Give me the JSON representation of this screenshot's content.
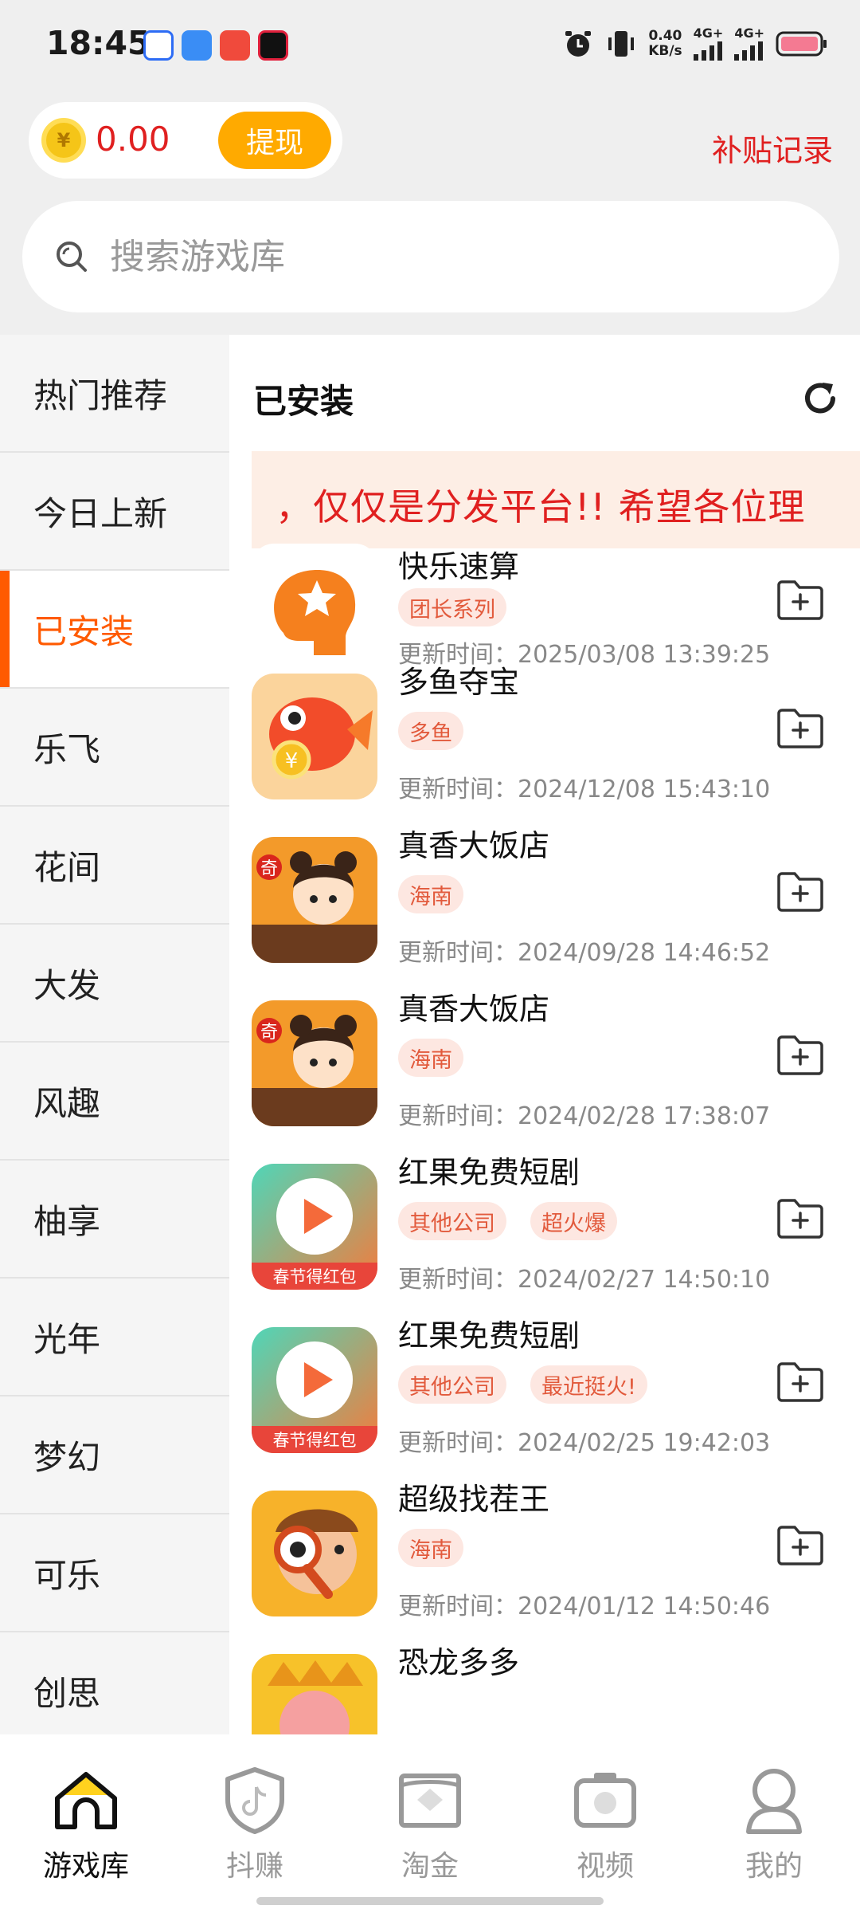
{
  "status_bar": {
    "time": "18:45",
    "net_speed_value": "0.40",
    "net_speed_unit": "KB/s",
    "sim1": "4G+",
    "sim2": "4G+",
    "icons": [
      "baidu-icon",
      "files-icon",
      "app-icon",
      "douyin-icon",
      "alarm-icon",
      "vibrate-icon",
      "signal-icon",
      "battery-icon"
    ]
  },
  "header": {
    "balance": "0.00",
    "coin_symbol": "¥",
    "withdraw_label": "提现",
    "subsidy_link": "补贴记录"
  },
  "search": {
    "placeholder": "搜索游戏库"
  },
  "sidebar": {
    "items": [
      {
        "label": "热门推荐"
      },
      {
        "label": "今日上新"
      },
      {
        "label": "已安装",
        "active": true
      },
      {
        "label": "乐飞"
      },
      {
        "label": "花间"
      },
      {
        "label": "大发"
      },
      {
        "label": "风趣"
      },
      {
        "label": "柚享"
      },
      {
        "label": "光年"
      },
      {
        "label": "梦幻"
      },
      {
        "label": "可乐"
      },
      {
        "label": "创思"
      }
    ]
  },
  "main": {
    "section_title": "已安装",
    "notice": "，仅仅是分发平台!!  希望各位理",
    "time_prefix": "更新时间：",
    "games": [
      {
        "name": "快乐速算",
        "tags": [
          "团长系列"
        ],
        "updated": "2025/03/08 13:39:25",
        "icon": "brain-star-icon"
      },
      {
        "name": "多鱼夺宝",
        "tags": [
          "多鱼"
        ],
        "updated": "2024/12/08 15:43:10",
        "icon": "goldfish-icon"
      },
      {
        "name": "真香大饭店",
        "tags": [
          "海南"
        ],
        "updated": "2024/09/28 14:46:52",
        "icon": "chef-girl-icon"
      },
      {
        "name": "真香大饭店",
        "tags": [
          "海南"
        ],
        "updated": "2024/02/28 17:38:07",
        "icon": "chef-girl-icon"
      },
      {
        "name": "红果免费短剧",
        "tags": [
          "其他公司",
          "超火爆"
        ],
        "updated": "2024/02/27 14:50:10",
        "icon": "play-icon"
      },
      {
        "name": "红果免费短剧",
        "tags": [
          "其他公司",
          "最近挺火!"
        ],
        "updated": "2024/02/25 19:42:03",
        "icon": "play-icon"
      },
      {
        "name": "超级找茬王",
        "tags": [
          "海南"
        ],
        "updated": "2024/01/12 14:50:46",
        "icon": "detective-icon"
      },
      {
        "name": "恐龙多多",
        "tags": [],
        "updated": "",
        "icon": "dinosaur-icon"
      }
    ]
  },
  "icon_captions": {
    "play_banner": "春节得红包",
    "chef_badge": "奇"
  },
  "bottom_nav": {
    "items": [
      {
        "label": "游戏库",
        "active": true
      },
      {
        "label": "抖赚"
      },
      {
        "label": "淘金"
      },
      {
        "label": "视频"
      },
      {
        "label": "我的"
      }
    ]
  },
  "colors": {
    "accent": "#ff5a00",
    "red_text": "#e02020",
    "withdraw_button": "#ffaa00",
    "tag_bg": "#fde7e1",
    "tag_text": "#e25a3c"
  }
}
